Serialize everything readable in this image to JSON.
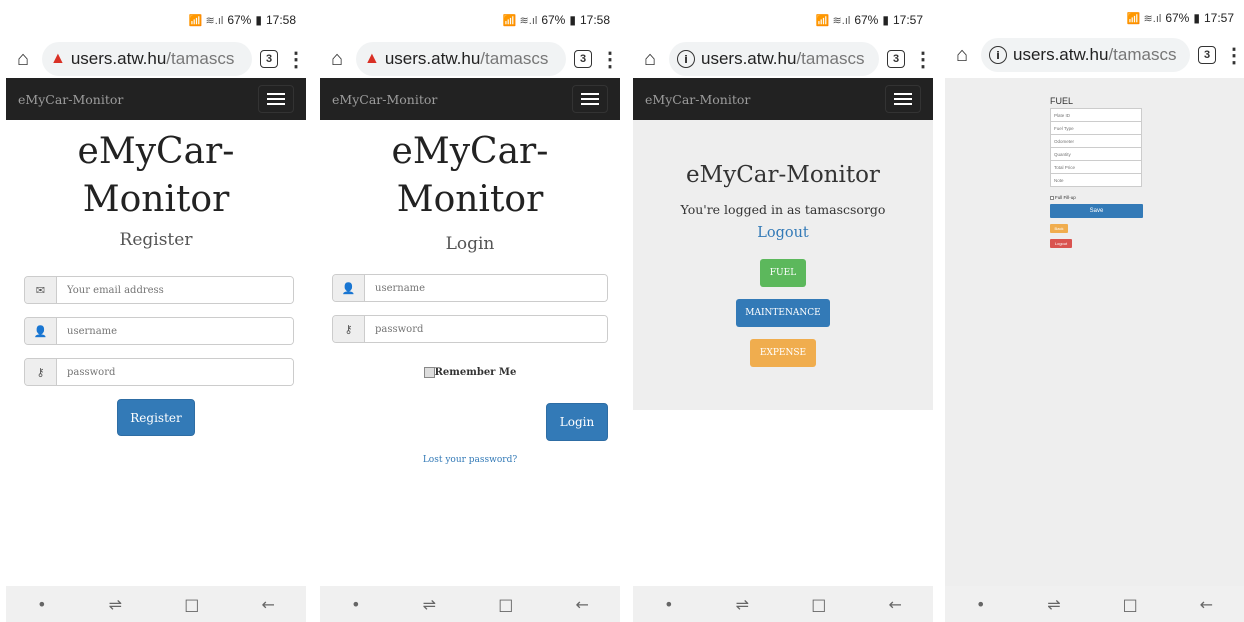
{
  "statusbar": [
    {
      "signal": "📶 ≋.ıl",
      "battery": "67%",
      "time": "17:58"
    },
    {
      "signal": "📶 ≋.ıl",
      "battery": "67%",
      "time": "17:58"
    },
    {
      "signal": "📶 ≋.ıl",
      "battery": "67%",
      "time": "17:57"
    },
    {
      "signal": "📶 ≋.ıl",
      "battery": "67%",
      "time": "17:57"
    }
  ],
  "urlbar": [
    {
      "domain": "users.atw.hu",
      "path": "/tamascs",
      "tabs": "3",
      "security": "warning"
    },
    {
      "domain": "users.atw.hu",
      "path": "/tamascs",
      "tabs": "3",
      "security": "warning"
    },
    {
      "domain": "users.atw.hu",
      "path": "/tamascs",
      "tabs": "3",
      "security": "info"
    },
    {
      "domain": "users.atw.hu",
      "path": "/tamascs",
      "tabs": "3",
      "security": "info"
    }
  ],
  "brand": "eMyCar-Monitor",
  "register": {
    "title_line1": "eMyCar-",
    "title_line2": "Monitor",
    "subtitle": "Register",
    "email_placeholder": "Your email address",
    "username_placeholder": "username",
    "password_placeholder": "password",
    "button": "Register"
  },
  "login": {
    "title_line1": "eMyCar-",
    "title_line2": "Monitor",
    "subtitle": "Login",
    "username_placeholder": "username",
    "password_placeholder": "password",
    "remember": "Remember Me",
    "button": "Login",
    "lost": "Lost your password?"
  },
  "dashboard": {
    "title": "eMyCar-Monitor",
    "logged_in": "You're logged in as tamascsorgo",
    "logout": "Logout",
    "fuel": "FUEL",
    "maintenance": "MAINTENANCE",
    "expense": "EXPENSE"
  },
  "fuel_form": {
    "title": "FUEL",
    "fields": [
      "Plate ID",
      "Fuel Type",
      "Odometer",
      "Quantity",
      "Total Price",
      "Note"
    ],
    "fillup": "Full Fill-up",
    "save": "Save",
    "back": "Back",
    "logout": "Logout"
  },
  "colors": {
    "primary": "#337ab7",
    "success": "#5cb85c",
    "warning": "#f0ad4e",
    "danger": "#d9534f",
    "navbar": "#222222"
  }
}
